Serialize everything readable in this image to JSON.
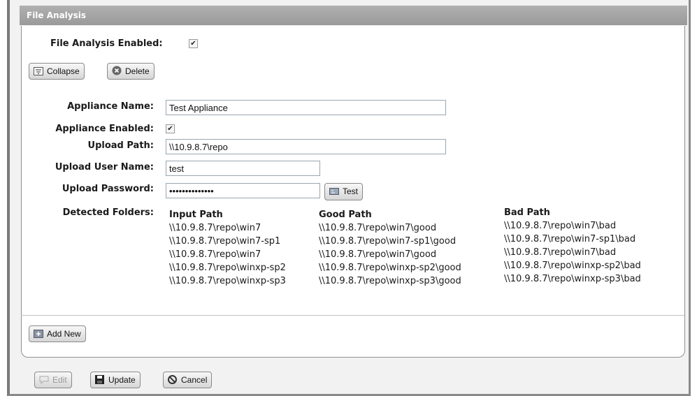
{
  "panel": {
    "title": "File Analysis"
  },
  "file_analysis": {
    "enabled_label": "File Analysis Enabled:",
    "enabled": true
  },
  "toolbar": {
    "collapse_label": "Collapse",
    "delete_label": "Delete"
  },
  "form": {
    "appliance_name_label": "Appliance Name:",
    "appliance_name_value": "Test Appliance",
    "appliance_enabled_label": "Appliance Enabled:",
    "appliance_enabled": true,
    "upload_path_label": "Upload Path:",
    "upload_path_value": "\\\\10.9.8.7\\repo",
    "upload_user_label": "Upload User Name:",
    "upload_user_value": "test",
    "upload_password_label": "Upload Password:",
    "upload_password_value": "••••••••••••••",
    "test_label": "Test",
    "detected_folders_label": "Detected Folders:"
  },
  "folders": {
    "headers": [
      "Input Path",
      "Good Path",
      "Bad Path"
    ],
    "rows": [
      [
        "\\\\10.9.8.7\\repo\\win7",
        "\\\\10.9.8.7\\repo\\win7\\good",
        "\\\\10.9.8.7\\repo\\win7\\bad"
      ],
      [
        "\\\\10.9.8.7\\repo\\win7-sp1",
        "\\\\10.9.8.7\\repo\\win7-sp1\\good",
        "\\\\10.9.8.7\\repo\\win7-sp1\\bad"
      ],
      [
        "\\\\10.9.8.7\\repo\\win7",
        "\\\\10.9.8.7\\repo\\win7\\good",
        "\\\\10.9.8.7\\repo\\win7\\bad"
      ],
      [
        "\\\\10.9.8.7\\repo\\winxp-sp2",
        "\\\\10.9.8.7\\repo\\winxp-sp2\\good",
        "\\\\10.9.8.7\\repo\\winxp-sp2\\bad"
      ],
      [
        "\\\\10.9.8.7\\repo\\winxp-sp3",
        "\\\\10.9.8.7\\repo\\winxp-sp3\\good",
        "\\\\10.9.8.7\\repo\\winxp-sp3\\bad"
      ]
    ]
  },
  "add_new_label": "Add New",
  "footer": {
    "edit_label": "Edit",
    "update_label": "Update",
    "cancel_label": "Cancel"
  },
  "icons": {
    "collapse": "collapse-icon",
    "delete": "delete-icon",
    "test": "test-icon",
    "add": "add-icon",
    "edit": "edit-icon",
    "update": "save-icon",
    "cancel": "cancel-icon"
  }
}
